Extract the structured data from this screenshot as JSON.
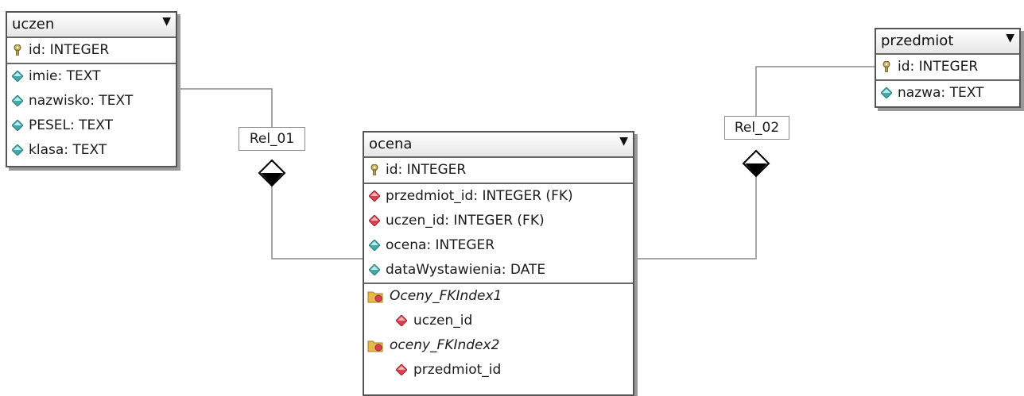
{
  "tables": {
    "uczen": {
      "title": "uczen",
      "columns": [
        {
          "label": "id: INTEGER",
          "icon": "key-icon"
        },
        {
          "label": "imie: TEXT",
          "icon": "attribute-icon"
        },
        {
          "label": "nazwisko: TEXT",
          "icon": "attribute-icon"
        },
        {
          "label": "PESEL: TEXT",
          "icon": "attribute-icon"
        },
        {
          "label": "klasa: TEXT",
          "icon": "attribute-icon"
        }
      ]
    },
    "przedmiot": {
      "title": "przedmiot",
      "columns": [
        {
          "label": "id: INTEGER",
          "icon": "key-icon"
        },
        {
          "label": "nazwa: TEXT",
          "icon": "attribute-icon"
        }
      ]
    },
    "ocena": {
      "title": "ocena",
      "columns": [
        {
          "label": "id: INTEGER",
          "icon": "key-icon"
        },
        {
          "label": "przedmiot_id: INTEGER (FK)",
          "icon": "foreign-key-icon"
        },
        {
          "label": "uczen_id: INTEGER (FK)",
          "icon": "foreign-key-icon"
        },
        {
          "label": "ocena: INTEGER",
          "icon": "attribute-icon"
        },
        {
          "label": "dataWystawienia: DATE",
          "icon": "attribute-icon"
        }
      ],
      "indexes": [
        {
          "name": "Oceny_FKIndex1",
          "column": "uczen_id"
        },
        {
          "name": "oceny_FKIndex2",
          "column": "przedmiot_id"
        }
      ]
    }
  },
  "relations": [
    {
      "label": "Rel_01"
    },
    {
      "label": "Rel_02"
    }
  ],
  "colors": {
    "attribute": "#45a7a7",
    "foreign_key": "#d9414f",
    "key": "#b59d4a",
    "folder": "#e8b84a"
  }
}
